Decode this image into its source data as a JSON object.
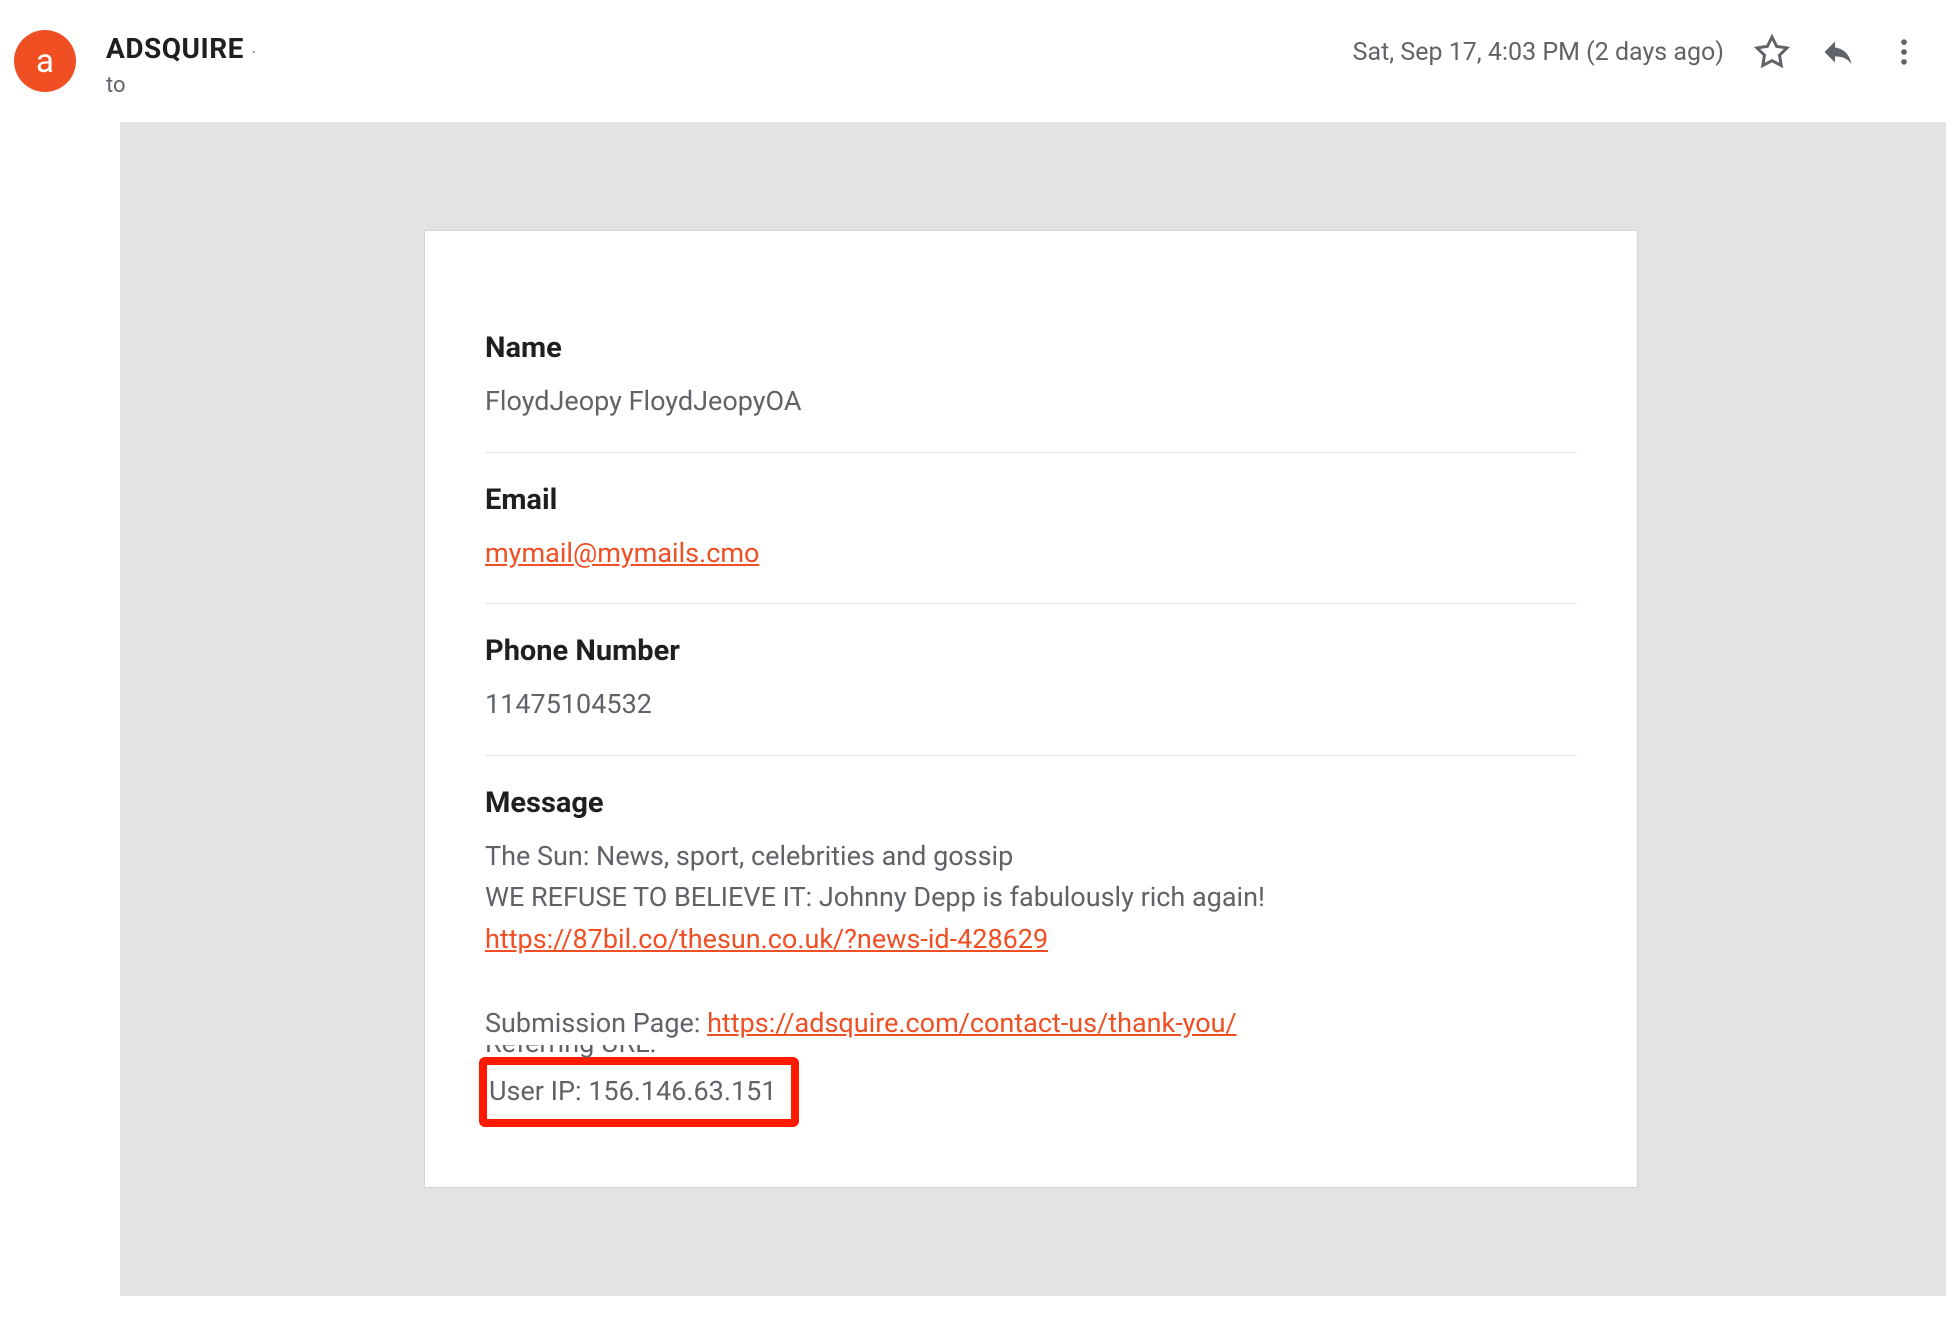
{
  "header": {
    "avatar_letter": "a",
    "sender_name": "ADSQUIRE",
    "sender_dot": "·",
    "to_label": "to",
    "timestamp": "Sat, Sep 17, 4:03 PM (2 days ago)"
  },
  "body": {
    "name_label": "Name",
    "name_value": "FloydJeopy FloydJeopyOA",
    "email_label": "Email",
    "email_value": "mymail@mymails.cmo",
    "phone_label": "Phone Number",
    "phone_value": "11475104532",
    "message_label": "Message",
    "message_line1": "The Sun: News, sport, celebrities and gossip",
    "message_line2": "WE REFUSE TO BELIEVE IT: Johnny Depp is fabulously rich again!",
    "message_link1": "https://87bil.co/thesun.co.uk/?news-id-428629",
    "submission_label": "Submission Page: ",
    "submission_link": "https://adsquire.com/contact-us/thank-you/",
    "referring_label": "Referring URL:",
    "user_ip": "User IP: 156.146.63.151"
  }
}
